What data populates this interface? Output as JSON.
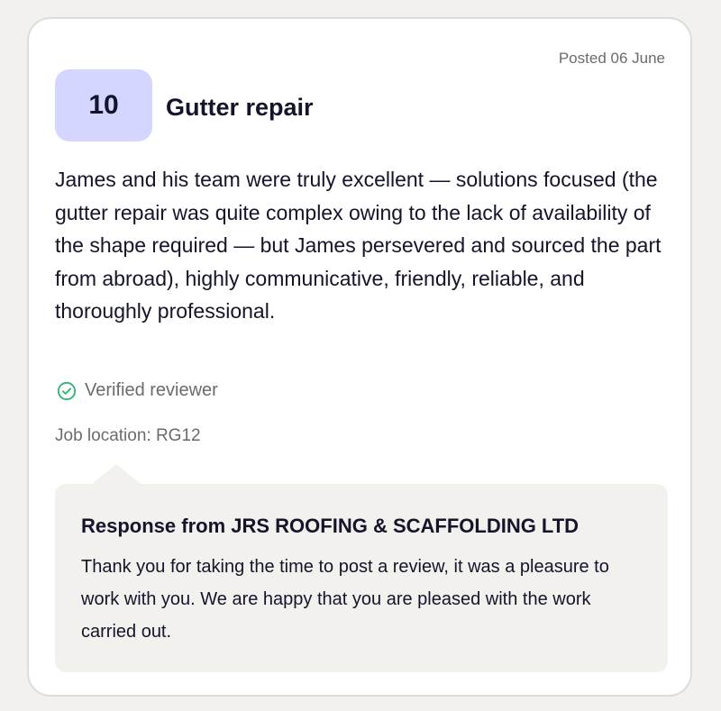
{
  "review": {
    "posted_date": "Posted 06 June",
    "score": "10",
    "title": "Gutter repair",
    "text": "James and his team were truly excellent — solutions focused (the gutter repair was quite complex owing to the lack of availability of the shape required — but James persevered and sourced the part from abroad), highly communicative, friendly, reliable, and thoroughly professional.",
    "verified_label": "Verified reviewer",
    "location": "Job location: RG12"
  },
  "response": {
    "title": "Response from JRS ROOFING & SCAFFOLDING LTD",
    "text": "Thank you for taking the time to post a review, it was a pleasure to work with you. We are happy that you are pleased with the work carried out."
  },
  "icons": {
    "verified": "check-circle-icon"
  },
  "colors": {
    "score_badge_bg": "#d4d6ff",
    "verified_green": "#2bb673",
    "response_bg": "#f2f1ee",
    "muted_text": "#6b6b6b"
  }
}
